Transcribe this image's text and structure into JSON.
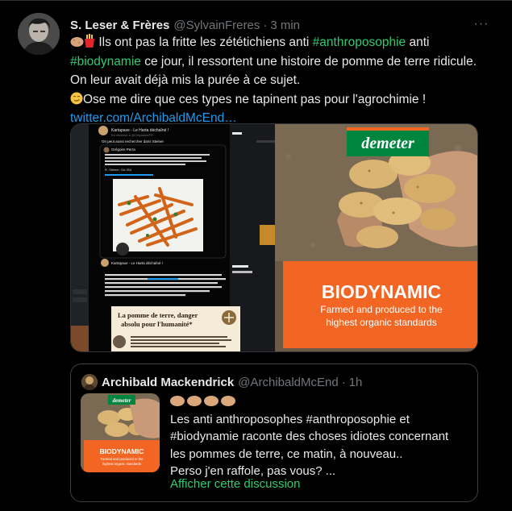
{
  "tweet": {
    "author_name": "S. Leser & Frères",
    "author_handle": "@SylvainFreres",
    "time": "3 min",
    "separator": "·",
    "more_label": "···",
    "line1_prefix": "Ils ont pas la fritte les zététichiens anti ",
    "hashtag1": "#anthroposophie",
    "line1_suffix": " anti",
    "hashtag2": "#biodynamie",
    "line2_suffix": " ce jour, il ressortent une histoire de pomme de terre ridicule.",
    "line3": "On leur avait déjà mis la purée à ce sujet.",
    "line4": "Ose me dire que ces types ne tapinent pas pour l'agrochimie !",
    "link": "twitter.com/ArchibaldMcEnd…",
    "emoji_line1": [
      "potato-icon",
      "fries-icon"
    ],
    "emoji_line4": "smirk-face-icon"
  },
  "media": {
    "left_image": {
      "header_name": "Kartapaxe - Le Harta déchaîné !",
      "header_line": "En réponse à @CmpaAxeFR",
      "sub": "On peut aussi rechercher dans Steiner",
      "quoted_name": "Grégoire Perra",
      "quoted_text": "Le savoirs-vous ? Selon l'anthroposophie, la pomme de terre est mauvaise...",
      "quoted_source": "R. Steiner, GA 354",
      "second_name": "Kartapaxe - Le Harta déchaîné !",
      "second_text": "Saviez vous que la pomme de terre est un danger pour l'humanité dans l'#anthroposophie ? Je vous l'explique dans cette infographie. Du coup c'est autorisé en #biodynamie ? une importante raison est aussi le racisme de Steiner que je ne vous pas relayer)",
      "infographic_title": "La pomme de terre, danger absolu pour l'humanité*",
      "infographic_text": "Rudolf Steiner, créateur de la biodynamie (agriculture), fondateur de l'anthroposophie (religion) et de la 'pédagogie Steiner-Waldorf' (enseignement) tenait activement contre la pomme de terre"
    },
    "right_image": {
      "brand": "demeter",
      "title": "BIODYNAMIC",
      "subtitle_1": "Farmed and produced to the",
      "subtitle_2": "highest organic standards",
      "orange": "#f26522",
      "brand_green": "#00853f"
    }
  },
  "quote": {
    "author_name": "Archibald Mackendrick",
    "author_handle": "@ArchibaldMcEnd",
    "time": "1h",
    "separator": "·",
    "line1": "Les anti anthroposophes #anthroposophie et",
    "line2": "#biodynamie raconte des choses idiotes concernant",
    "line3": "les pommes de terre, ce matin, à nouveau..",
    "line4": "Perso j'en raffole, pas vous? ...",
    "show_thread": "Afficher cette discussion",
    "emoji_row": [
      "potato-icon",
      "potato-icon",
      "potato-icon",
      "potato-icon"
    ],
    "thumb": {
      "brand": "demeter",
      "title": "BIODYNAMIC",
      "subtitle_1": "Farmed and produced to the",
      "subtitle_2": "highest organic standards"
    }
  },
  "colors": {
    "background": "#000000",
    "text": "#e7e9ea",
    "muted": "#71767b",
    "hashtag": "#2ecc71",
    "link": "#1d9bf0"
  }
}
